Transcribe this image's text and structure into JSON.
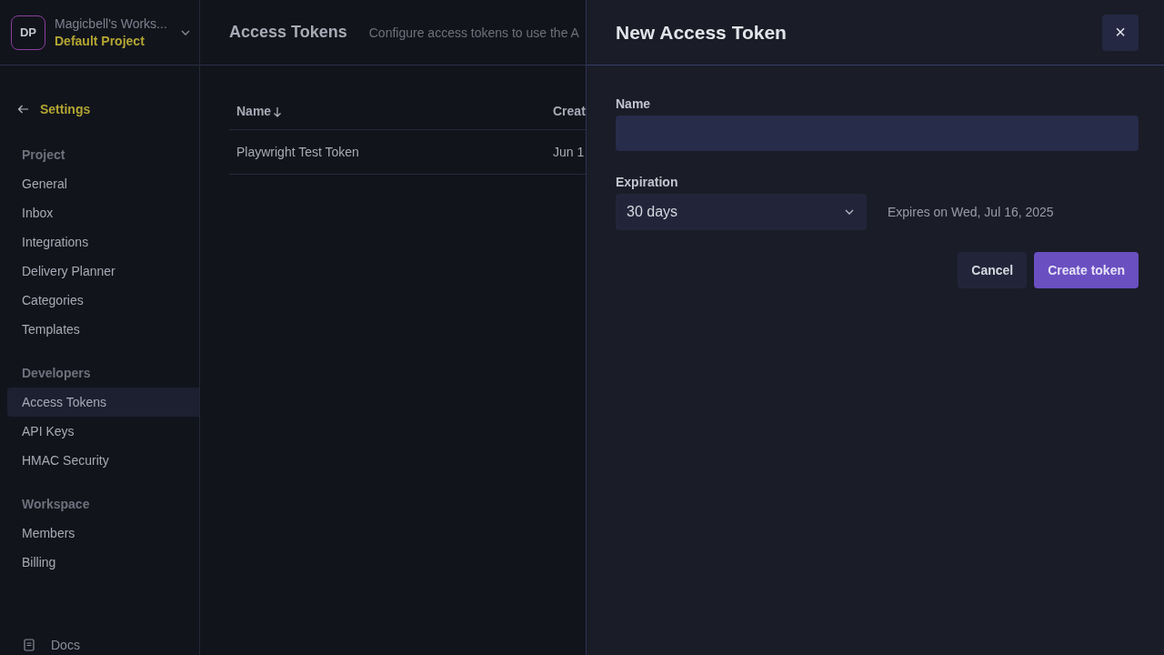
{
  "workspace": {
    "initials": "DP",
    "name": "Magicbell's Works...",
    "project": "Default Project"
  },
  "back": {
    "label": "Settings"
  },
  "nav": [
    {
      "heading": "Project",
      "items": [
        {
          "label": "General",
          "selected": false
        },
        {
          "label": "Inbox",
          "selected": false
        },
        {
          "label": "Integrations",
          "selected": false
        },
        {
          "label": "Delivery Planner",
          "selected": false
        },
        {
          "label": "Categories",
          "selected": false
        },
        {
          "label": "Templates",
          "selected": false
        }
      ]
    },
    {
      "heading": "Developers",
      "items": [
        {
          "label": "Access Tokens",
          "selected": true
        },
        {
          "label": "API Keys",
          "selected": false
        },
        {
          "label": "HMAC Security",
          "selected": false
        }
      ]
    },
    {
      "heading": "Workspace",
      "items": [
        {
          "label": "Members",
          "selected": false
        },
        {
          "label": "Billing",
          "selected": false
        }
      ]
    }
  ],
  "footer_link": {
    "label": "Docs"
  },
  "page": {
    "title": "Access Tokens",
    "description": "Configure access tokens to use the A"
  },
  "table": {
    "columns": [
      {
        "label": "Name",
        "sorted": true
      },
      {
        "label": "Creat",
        "sorted": false
      }
    ],
    "rows": [
      [
        "Playwright Test Token",
        "Jun 1"
      ]
    ]
  },
  "drawer": {
    "title": "New Access Token",
    "close": "×",
    "fields": [
      {
        "label": "Name"
      }
    ],
    "expiration": {
      "label": "Expiration",
      "value": "30 days",
      "note": "Expires on Wed, Jul 16, 2025"
    },
    "buttons": [
      {
        "label": "Cancel",
        "kind": "secondary"
      },
      {
        "label": "Create token",
        "kind": "primary"
      }
    ]
  }
}
